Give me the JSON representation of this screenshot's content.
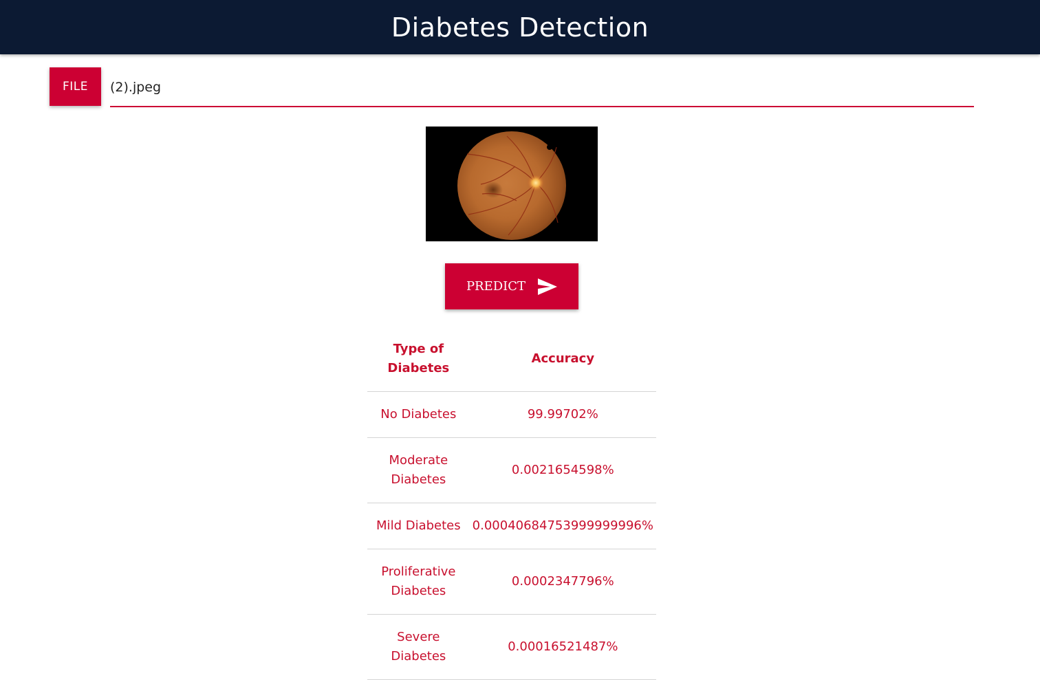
{
  "header": {
    "title": "Diabetes Detection"
  },
  "file_input": {
    "button_label": "FILE",
    "path_value": "(2).jpeg"
  },
  "preview": {
    "alt": "retinal fundus image"
  },
  "predict_button": {
    "label": "PREDICT",
    "icon": "send-icon"
  },
  "results": {
    "columns": [
      "Type of Diabetes",
      "Accuracy"
    ],
    "rows": [
      {
        "type": "No Diabetes",
        "accuracy": "99.99702%"
      },
      {
        "type": "Moderate Diabetes",
        "accuracy": "0.0021654598%"
      },
      {
        "type": "Mild Diabetes",
        "accuracy": "0.00040684753999999996%"
      },
      {
        "type": "Proliferative Diabetes",
        "accuracy": "0.0002347796%"
      },
      {
        "type": "Severe Diabetes",
        "accuracy": "0.00016521487%"
      }
    ]
  },
  "colors": {
    "header_bg": "#0c1a33",
    "accent": "#cc0033",
    "table_text": "#c8102e"
  }
}
